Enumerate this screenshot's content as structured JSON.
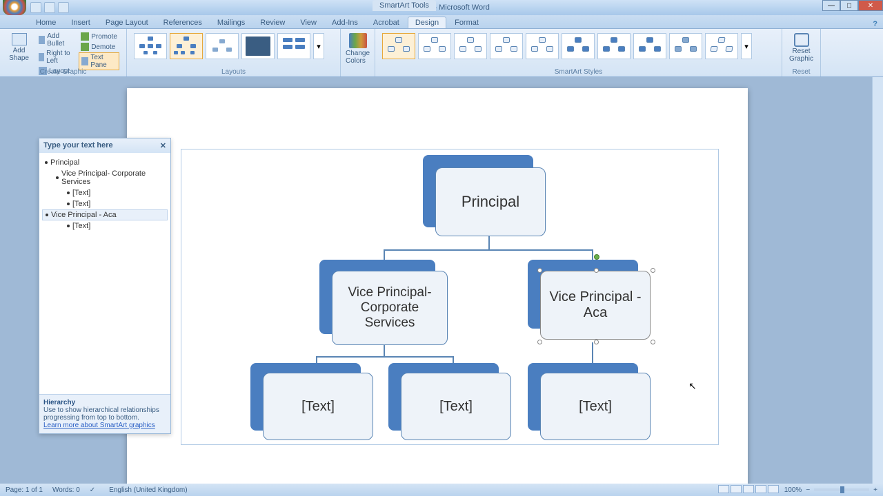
{
  "title": "Document5 - Microsoft Word",
  "tool_tab": "SmartArt Tools",
  "tabs": [
    "Home",
    "Insert",
    "Page Layout",
    "References",
    "Mailings",
    "Review",
    "View",
    "Add-Ins",
    "Acrobat",
    "Design",
    "Format"
  ],
  "active_tab_index": 9,
  "ribbon": {
    "create_graphic": {
      "label": "Create Graphic",
      "add_shape": "Add Shape",
      "add_bullet": "Add Bullet",
      "rtl": "Right to Left",
      "layout": "Layout",
      "promote": "Promote",
      "demote": "Demote",
      "text_pane": "Text Pane"
    },
    "layouts": {
      "label": "Layouts"
    },
    "change_colors": "Change Colors",
    "styles": {
      "label": "SmartArt Styles"
    },
    "reset": {
      "label": "Reset",
      "btn": "Reset Graphic"
    }
  },
  "textpane": {
    "title": "Type your text here",
    "items": [
      {
        "level": 0,
        "text": "Principal"
      },
      {
        "level": 1,
        "text": "Vice Principal- Corporate Services"
      },
      {
        "level": 2,
        "text": "[Text]"
      },
      {
        "level": 2,
        "text": "[Text]"
      },
      {
        "level": 1,
        "text": "Vice Principal -  Aca",
        "selected": true
      },
      {
        "level": 2,
        "text": "[Text]"
      }
    ],
    "footer_title": "Hierarchy",
    "footer_desc": "Use to show hierarchical relationships progressing from top to bottom.",
    "footer_link": "Learn more about SmartArt graphics"
  },
  "org": {
    "principal": "Principal",
    "vp1": "Vice Principal- Corporate Services",
    "vp2": "Vice Principal -  Aca",
    "placeholder": "[Text]"
  },
  "status": {
    "page": "Page: 1 of 1",
    "words": "Words: 0",
    "lang": "English (United Kingdom)",
    "zoom": "100%"
  }
}
